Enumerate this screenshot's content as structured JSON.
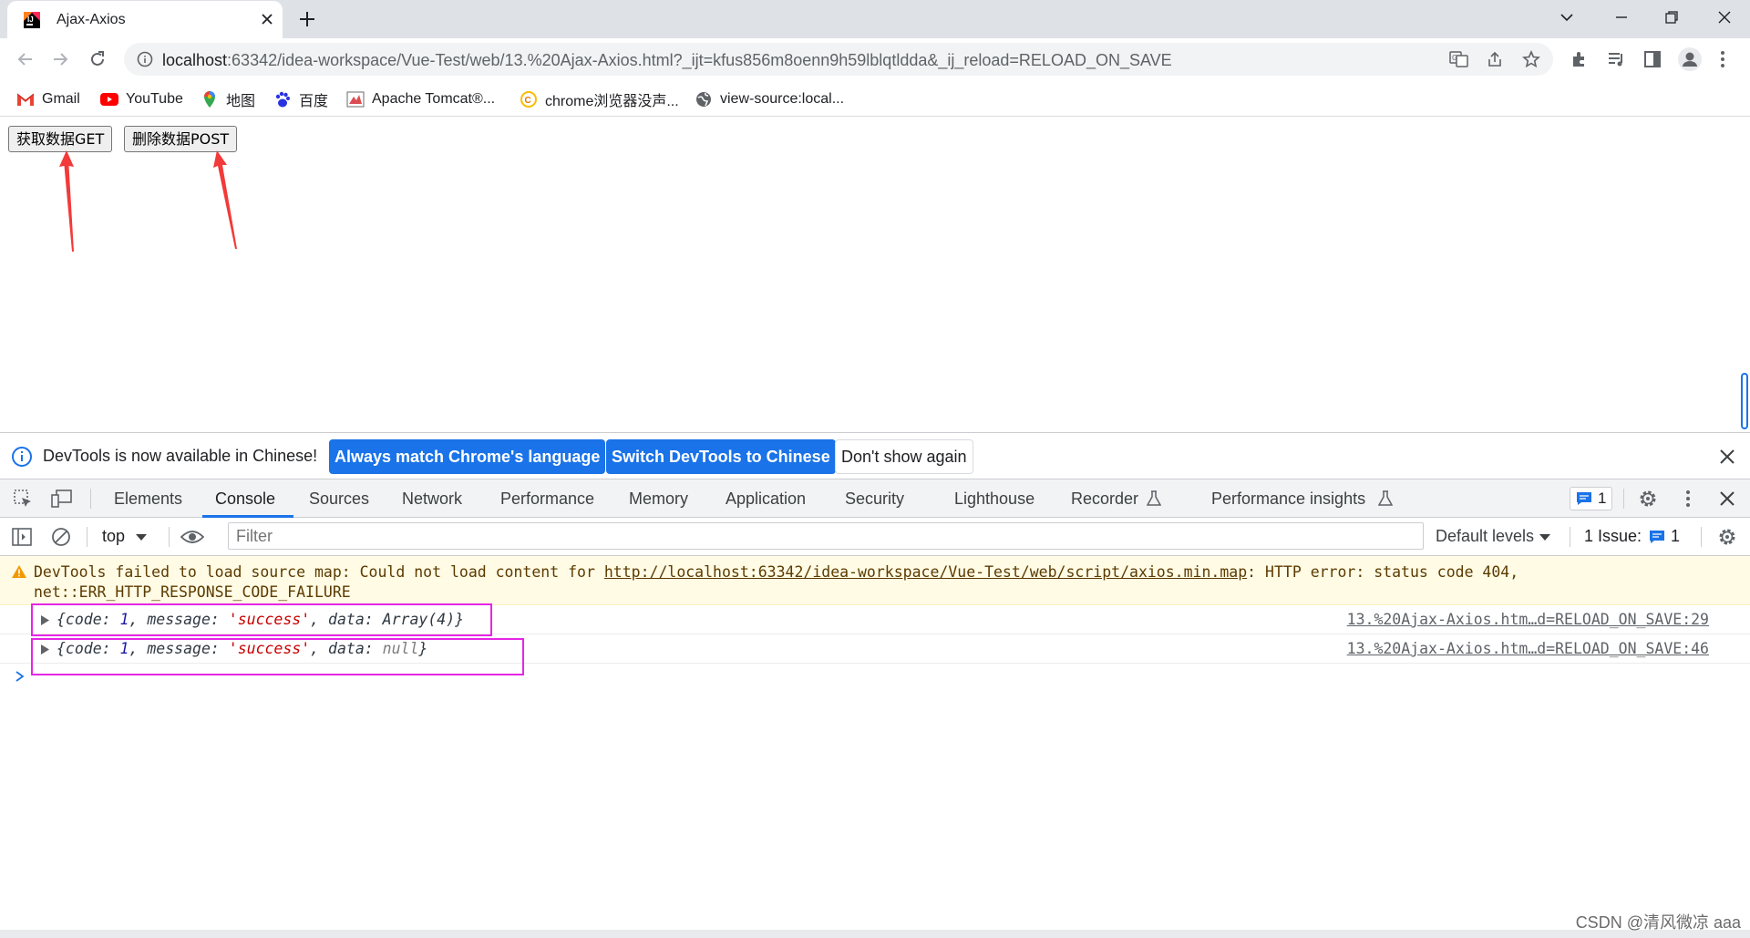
{
  "browser": {
    "tab_title": "Ajax-Axios",
    "url_host": "localhost",
    "url_rest": ":63342/idea-workspace/Vue-Test/web/13.%20Ajax-Axios.html?_ijt=kfus856m8oenn9h59lblqtldda&_ij_reload=RELOAD_ON_SAVE",
    "bookmarks": [
      "Gmail",
      "YouTube",
      "地图",
      "百度",
      "Apache Tomcat®...",
      "chrome浏览器没声...",
      "view-source:local..."
    ]
  },
  "page": {
    "get_button": "获取数据GET",
    "post_button": "删除数据POST"
  },
  "infobar": {
    "message": "DevTools is now available in Chinese!",
    "btn_match": "Always match Chrome's language",
    "btn_switch": "Switch DevTools to Chinese",
    "btn_dismiss": "Don't show again"
  },
  "devtools": {
    "tabs": [
      "Elements",
      "Console",
      "Sources",
      "Network",
      "Performance",
      "Memory",
      "Application",
      "Security",
      "Lighthouse",
      "Recorder",
      "Performance insights"
    ],
    "active_tab": "Console",
    "issues_badge": "1",
    "context": "top",
    "filter_placeholder": "Filter",
    "levels": "Default levels",
    "issue_label": "1 Issue:",
    "issue_count": "1"
  },
  "console": {
    "warning_line1_pre": "DevTools failed to load source map: Could not load content for ",
    "warning_link": "http://localhost:63342/idea-workspace/Vue-Test/web/script/axios.min.map",
    "warning_line1_post": ": HTTP error: status code 404,",
    "warning_line2": "net::ERR_HTTP_RESPONSE_CODE_FAILURE",
    "logs": [
      {
        "code": "1",
        "message": "'success'",
        "data": "Array(4)",
        "source": "13.%20Ajax-Axios.htm…d=RELOAD_ON_SAVE:29"
      },
      {
        "code": "1",
        "message": "'success'",
        "data": "null",
        "source": "13.%20Ajax-Axios.htm…d=RELOAD_ON_SAVE:46"
      }
    ]
  },
  "watermark": "CSDN @清风微凉 aaa",
  "colors": {
    "accent": "#1a73e8",
    "highlight_box": "#e526e5",
    "arrow": "#f23a3a",
    "warning_bg": "#fffbe5"
  }
}
